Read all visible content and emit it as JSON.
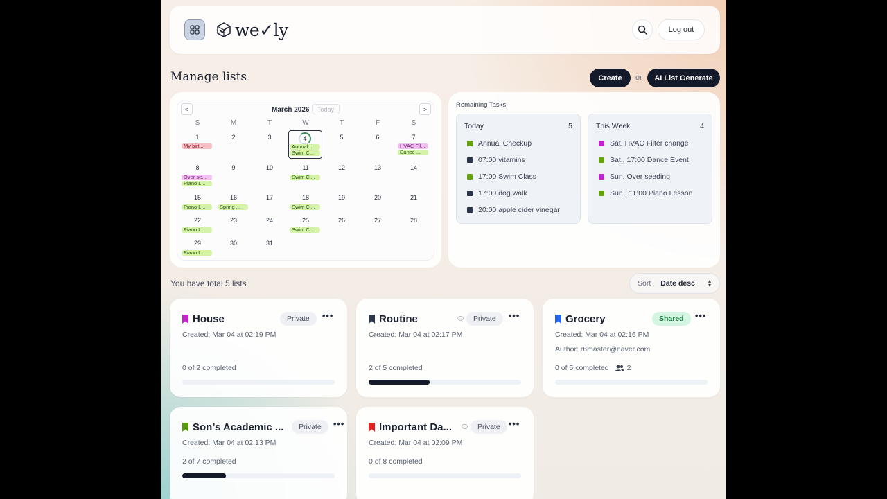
{
  "header": {
    "logo_text": "we✓ly",
    "logout_label": "Log out"
  },
  "toolbar": {
    "title": "Manage lists",
    "create_label": "Create",
    "or_label": "or",
    "ai_label": "AI List Generate"
  },
  "calendar": {
    "month": "March 2026",
    "today_label": "Today",
    "prev_label": "<",
    "next_label": ">",
    "weekdays": [
      "S",
      "M",
      "T",
      "W",
      "T",
      "F",
      "S"
    ],
    "today_day": "4",
    "days": [
      "1",
      "2",
      "3",
      "4",
      "5",
      "6",
      "7",
      "8",
      "9",
      "10",
      "11",
      "12",
      "13",
      "14",
      "15",
      "16",
      "17",
      "18",
      "19",
      "20",
      "21",
      "22",
      "23",
      "24",
      "25",
      "26",
      "27",
      "28",
      "29",
      "30",
      "31"
    ],
    "events": {
      "e1": "My birt...",
      "e4a": "Annual...",
      "e4b": "Swim C...",
      "e7a": "HVAC Fil...",
      "e7b": "Dance ...",
      "e8a": "Over se...",
      "e8b": "Piano L...",
      "e11": "Swim Cl...",
      "e15": "Piano L...",
      "e16": "Spring ...",
      "e18": "Swim Cl...",
      "e22": "Piano L...",
      "e25": "Swim Cl...",
      "e29": "Piano L..."
    }
  },
  "tasks": {
    "title": "Remaining Tasks",
    "today": {
      "label": "Today",
      "count": "5",
      "items": [
        "Annual Checkup",
        "07:00 vitamins",
        "17:00 Swim Class",
        "17:00 dog walk",
        "20:00 apple cider vinegar"
      ]
    },
    "week": {
      "label": "This Week",
      "count": "4",
      "items": [
        "Sat. HVAC Filter change",
        "Sat., 17:00 Dance Event",
        "Sun. Over seeding",
        "Sun., 11:00 Piano Lesson"
      ]
    }
  },
  "summary": {
    "total_text": "You have total 5 lists",
    "sort_label": "Sort",
    "sort_value": "Date desc"
  },
  "lists": [
    {
      "name": "House",
      "badge": "Private",
      "created": "Created: Mar 04 at 02:19 PM",
      "completed": "0 of 2 completed",
      "progress": 0,
      "color": "#c026c8"
    },
    {
      "name": "Routine",
      "badge": "Private",
      "created": "Created: Mar 04 at 02:17 PM",
      "completed": "2 of 5 completed",
      "progress": 0.4,
      "color": "#2c3648"
    },
    {
      "name": "Grocery",
      "badge": "Shared",
      "created": "Created: Mar 04 at 02:16 PM",
      "author": "Author: r6master@naver.com",
      "completed": "0 of 5 completed",
      "members": "2",
      "progress": 0,
      "color": "#2563eb"
    },
    {
      "name": "Son’s Academic ...",
      "badge": "Private",
      "created": "Created: Mar 04 at 02:13 PM",
      "completed": "2 of 7 completed",
      "progress": 0.2857,
      "color": "#5a9a12"
    },
    {
      "name": "Important Da...",
      "badge": "Private",
      "created": "Created: Mar 04 at 02:09 PM",
      "completed": "0 of 8 completed",
      "progress": 0,
      "color": "#dc2626"
    }
  ],
  "colors": {
    "green": "#65a30d",
    "navy": "#2c3648",
    "magenta": "#c026c8"
  }
}
